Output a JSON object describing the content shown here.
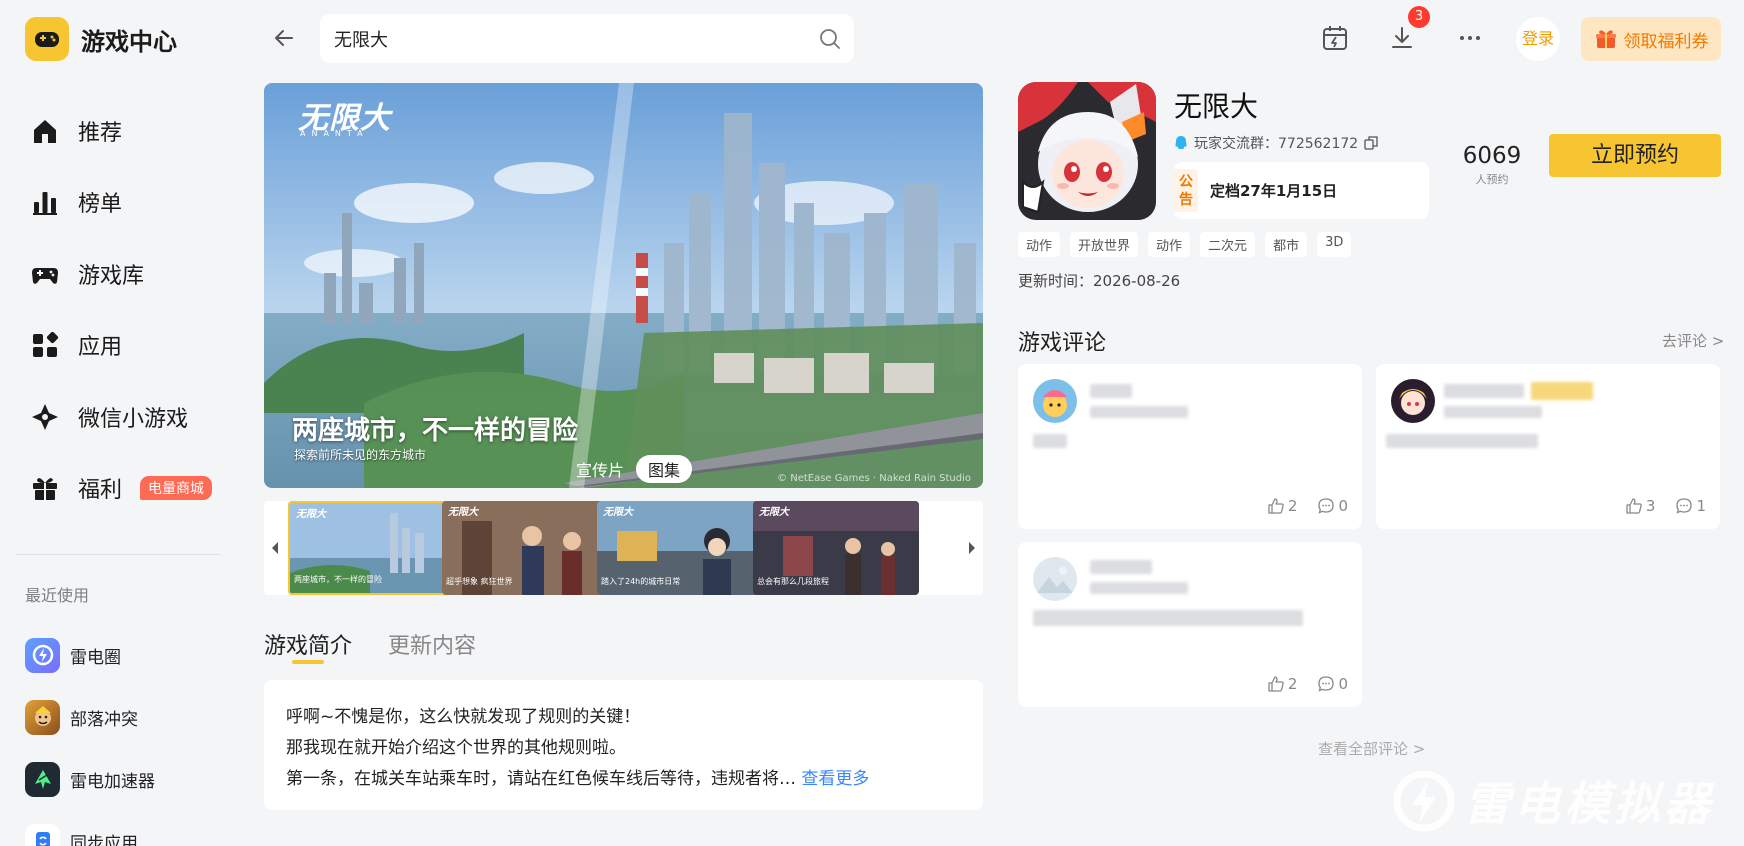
{
  "app": {
    "title": "游戏中心"
  },
  "nav": [
    {
      "label": "推荐",
      "icon": "house-icon"
    },
    {
      "label": "榜单",
      "icon": "ranking-icon"
    },
    {
      "label": "游戏库",
      "icon": "gamepad-icon"
    },
    {
      "label": "应用",
      "icon": "apps-icon"
    },
    {
      "label": "微信小游戏",
      "icon": "wechat-minigame-icon"
    },
    {
      "label": "福利",
      "icon": "gift-icon",
      "badge": "电量商城"
    }
  ],
  "recent": {
    "title": "最近使用",
    "items": [
      {
        "label": "雷电圈",
        "icon": "leidian-circle-icon"
      },
      {
        "label": "部落冲突",
        "icon": "clash-of-clans-icon"
      },
      {
        "label": "雷电加速器",
        "icon": "accelerator-icon"
      },
      {
        "label": "同步应用",
        "icon": "sync-app-icon"
      }
    ]
  },
  "topbar": {
    "search_value": "无限大",
    "download_badge": "3",
    "login_label": "登录",
    "coupon_label": "领取福利券"
  },
  "hero": {
    "logo_text": "无限大",
    "logo_sub": "ANANTA",
    "caption": "两座城市，不一样的冒险",
    "subcaption": "探索前所未见的东方城市",
    "tabs": [
      "宣传片",
      "图集"
    ],
    "active_tab": "图集",
    "copyright": "© NetEase Games · Naked Rain Studio"
  },
  "thumbnails": [
    {
      "logo": "无限大",
      "caption": "两座城市，不一样的冒险"
    },
    {
      "logo": "无限大",
      "caption": "超乎想象 疯狂世界"
    },
    {
      "logo": "无限大",
      "caption": "踏入了24h的城市日常"
    },
    {
      "logo": "无限大",
      "caption": "总会有那么几段旅程"
    }
  ],
  "intro": {
    "tabs": [
      "游戏简介",
      "更新内容"
    ],
    "active_tab": "游戏简介",
    "lines": [
      "呼啊~不愧是你，这么快就发现了规则的关键！",
      "那我现在就开始介绍这个世界的其他规则啦。",
      "第一条，在城关车站乘车时，请站在红色候车线后等待，违规者将…"
    ],
    "more_label": "查看更多"
  },
  "game": {
    "title": "无限大",
    "group_label": "玩家交流群：772562172",
    "notice_tag": "公告",
    "notice_tag_line1": "公",
    "notice_tag_line2": "告",
    "notice_text": "定档27年1月15日",
    "reserve_count": "6069",
    "reserve_count_label": "人预约",
    "reserve_button": "立即预约",
    "tags": [
      "动作",
      "开放世界",
      "动作",
      "二次元",
      "都市",
      "3D"
    ],
    "update_time": "更新时间：2026-08-26"
  },
  "reviews": {
    "title": "游戏评论",
    "write_link": "去评论 >",
    "items": [
      {
        "likes": "2",
        "comments": "0"
      },
      {
        "likes": "3",
        "comments": "1"
      },
      {
        "likes": "2",
        "comments": "0"
      }
    ],
    "all_link": "查看全部评论 >"
  },
  "watermark": {
    "text": "雷电模拟器"
  },
  "colors": {
    "accent": "#f7c531",
    "link": "#3b86ff",
    "badge_red": "#ff3b30",
    "background": "#f4f5f7"
  }
}
